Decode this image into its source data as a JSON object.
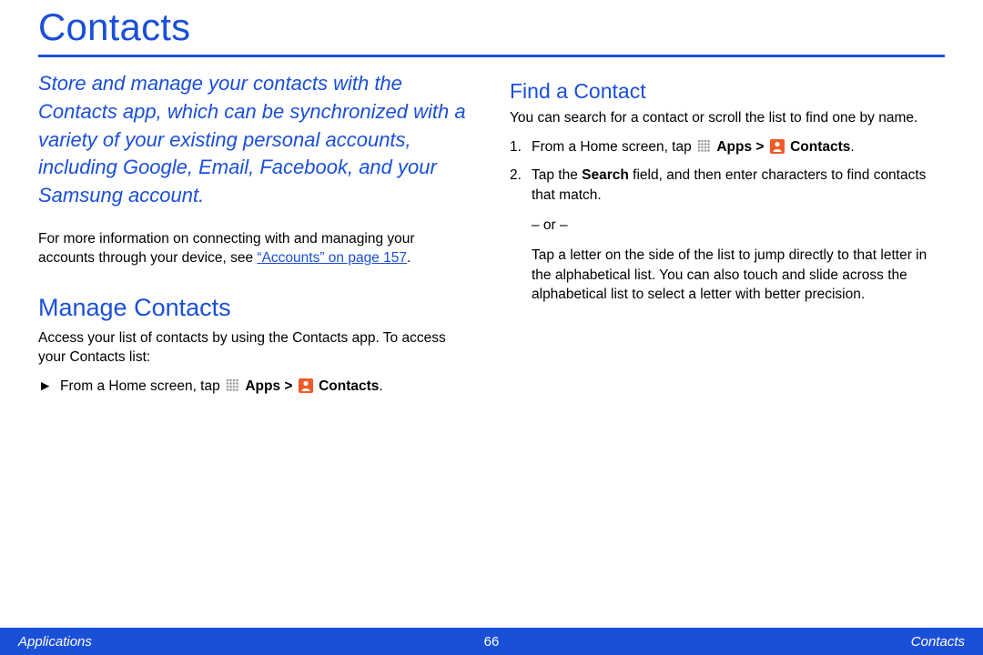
{
  "title": "Contacts",
  "intro": "Store and manage your contacts with the Contacts app, which can be synchronized with a variety of your existing personal accounts, including Google, Email, Facebook, and your Samsung account.",
  "more_info_prefix": "For more information on connecting with and managing your accounts through your device, see ",
  "accounts_link": "“Accounts” on page 157",
  "more_info_suffix": ".",
  "manage": {
    "heading": "Manage Contacts",
    "intro": "Access your list of contacts by using the Contacts app. To access your Contacts list:",
    "step_marker": "►",
    "step_pre": "From a Home screen, tap ",
    "apps_label": "Apps",
    "sep": " > ",
    "contacts_label": "Contacts",
    "step_suffix": "."
  },
  "find": {
    "heading": "Find a Contact",
    "intro": "You can search for a contact or scroll the list to find one by name.",
    "step1_num": "1.",
    "step1_pre": "From a Home screen, tap ",
    "step1_apps": "Apps",
    "step1_sep": " > ",
    "step1_contacts": "Contacts",
    "step1_suffix": ".",
    "step2_num": "2.",
    "step2_a": "Tap the ",
    "step2_search": "Search",
    "step2_b": " field, and then enter characters to find contacts that match.",
    "or_label": "– or –",
    "step2_alt": "Tap a letter on the side of the list to jump directly to that letter in the alphabetical list. You can also touch and slide across the alphabetical list to select a letter with better precision."
  },
  "footer": {
    "left": "Applications",
    "center": "66",
    "right": "Contacts"
  }
}
